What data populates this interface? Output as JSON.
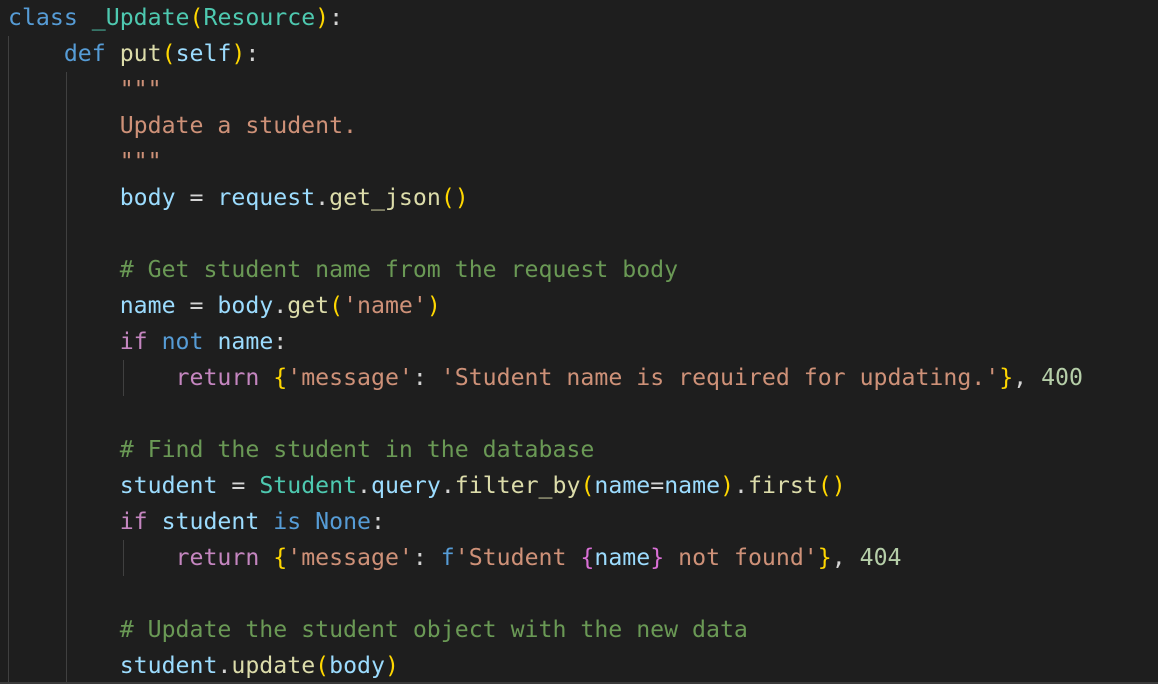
{
  "editor": {
    "background": "#1e1e1e",
    "token_colors": {
      "keyword": "#569cd6",
      "control": "#c586c0",
      "class": "#4ec9b0",
      "function": "#dcdcaa",
      "variable": "#9cdcfe",
      "string": "#ce9178",
      "comment": "#6a9955",
      "number": "#b5cea8",
      "bracket_1": "#ffd700",
      "bracket_2": "#da70d6"
    },
    "lines": [
      {
        "tokens": [
          {
            "t": "class",
            "c": "kw-decl"
          },
          {
            "t": " ",
            "c": "op"
          },
          {
            "t": "_Update",
            "c": "cls"
          },
          {
            "t": "(",
            "c": "b1"
          },
          {
            "t": "Resource",
            "c": "cls"
          },
          {
            "t": ")",
            "c": "b1"
          },
          {
            "t": ":",
            "c": "op"
          }
        ]
      },
      {
        "tokens": [
          {
            "t": "    ",
            "c": "op"
          },
          {
            "t": "def",
            "c": "kw-decl"
          },
          {
            "t": " ",
            "c": "op"
          },
          {
            "t": "put",
            "c": "fn"
          },
          {
            "t": "(",
            "c": "b1"
          },
          {
            "t": "self",
            "c": "var"
          },
          {
            "t": ")",
            "c": "b1"
          },
          {
            "t": ":",
            "c": "op"
          }
        ]
      },
      {
        "tokens": [
          {
            "t": "        ",
            "c": "op"
          },
          {
            "t": "\"\"\"",
            "c": "str"
          }
        ]
      },
      {
        "tokens": [
          {
            "t": "        ",
            "c": "op"
          },
          {
            "t": "Update a student.",
            "c": "str"
          }
        ]
      },
      {
        "tokens": [
          {
            "t": "        ",
            "c": "op"
          },
          {
            "t": "\"\"\"",
            "c": "str"
          }
        ]
      },
      {
        "tokens": [
          {
            "t": "        ",
            "c": "op"
          },
          {
            "t": "body",
            "c": "var"
          },
          {
            "t": " = ",
            "c": "op"
          },
          {
            "t": "request",
            "c": "var"
          },
          {
            "t": ".",
            "c": "op"
          },
          {
            "t": "get_json",
            "c": "fn"
          },
          {
            "t": "()",
            "c": "b1"
          }
        ]
      },
      {
        "tokens": []
      },
      {
        "tokens": [
          {
            "t": "        ",
            "c": "op"
          },
          {
            "t": "# Get student name from the request body",
            "c": "cmt"
          }
        ]
      },
      {
        "tokens": [
          {
            "t": "        ",
            "c": "op"
          },
          {
            "t": "name",
            "c": "var"
          },
          {
            "t": " = ",
            "c": "op"
          },
          {
            "t": "body",
            "c": "var"
          },
          {
            "t": ".",
            "c": "op"
          },
          {
            "t": "get",
            "c": "fn"
          },
          {
            "t": "(",
            "c": "b1"
          },
          {
            "t": "'name'",
            "c": "str"
          },
          {
            "t": ")",
            "c": "b1"
          }
        ]
      },
      {
        "tokens": [
          {
            "t": "        ",
            "c": "op"
          },
          {
            "t": "if",
            "c": "kw-ctrl"
          },
          {
            "t": " ",
            "c": "op"
          },
          {
            "t": "not",
            "c": "kw-decl"
          },
          {
            "t": " ",
            "c": "op"
          },
          {
            "t": "name",
            "c": "var"
          },
          {
            "t": ":",
            "c": "op"
          }
        ]
      },
      {
        "tokens": [
          {
            "t": "            ",
            "c": "op"
          },
          {
            "t": "return",
            "c": "kw-ctrl"
          },
          {
            "t": " ",
            "c": "op"
          },
          {
            "t": "{",
            "c": "b1"
          },
          {
            "t": "'message'",
            "c": "str"
          },
          {
            "t": ": ",
            "c": "op"
          },
          {
            "t": "'Student name is required for updating.'",
            "c": "str"
          },
          {
            "t": "}",
            "c": "b1"
          },
          {
            "t": ", ",
            "c": "op"
          },
          {
            "t": "400",
            "c": "num"
          }
        ]
      },
      {
        "tokens": []
      },
      {
        "tokens": [
          {
            "t": "        ",
            "c": "op"
          },
          {
            "t": "# Find the student in the database",
            "c": "cmt"
          }
        ]
      },
      {
        "tokens": [
          {
            "t": "        ",
            "c": "op"
          },
          {
            "t": "student",
            "c": "var"
          },
          {
            "t": " = ",
            "c": "op"
          },
          {
            "t": "Student",
            "c": "cls"
          },
          {
            "t": ".",
            "c": "op"
          },
          {
            "t": "query",
            "c": "var"
          },
          {
            "t": ".",
            "c": "op"
          },
          {
            "t": "filter_by",
            "c": "fn"
          },
          {
            "t": "(",
            "c": "b1"
          },
          {
            "t": "name",
            "c": "var"
          },
          {
            "t": "=",
            "c": "op"
          },
          {
            "t": "name",
            "c": "var"
          },
          {
            "t": ")",
            "c": "b1"
          },
          {
            "t": ".",
            "c": "op"
          },
          {
            "t": "first",
            "c": "fn"
          },
          {
            "t": "()",
            "c": "b1"
          }
        ]
      },
      {
        "tokens": [
          {
            "t": "        ",
            "c": "op"
          },
          {
            "t": "if",
            "c": "kw-ctrl"
          },
          {
            "t": " ",
            "c": "op"
          },
          {
            "t": "student",
            "c": "var"
          },
          {
            "t": " ",
            "c": "op"
          },
          {
            "t": "is",
            "c": "kw-decl"
          },
          {
            "t": " ",
            "c": "op"
          },
          {
            "t": "None",
            "c": "kw-decl"
          },
          {
            "t": ":",
            "c": "op"
          }
        ]
      },
      {
        "tokens": [
          {
            "t": "            ",
            "c": "op"
          },
          {
            "t": "return",
            "c": "kw-ctrl"
          },
          {
            "t": " ",
            "c": "op"
          },
          {
            "t": "{",
            "c": "b1"
          },
          {
            "t": "'message'",
            "c": "str"
          },
          {
            "t": ": ",
            "c": "op"
          },
          {
            "t": "f",
            "c": "kw-decl"
          },
          {
            "t": "'Student ",
            "c": "str"
          },
          {
            "t": "{",
            "c": "b2"
          },
          {
            "t": "name",
            "c": "var"
          },
          {
            "t": "}",
            "c": "b2"
          },
          {
            "t": " not found'",
            "c": "str"
          },
          {
            "t": "}",
            "c": "b1"
          },
          {
            "t": ", ",
            "c": "op"
          },
          {
            "t": "404",
            "c": "num"
          }
        ]
      },
      {
        "tokens": []
      },
      {
        "tokens": [
          {
            "t": "        ",
            "c": "op"
          },
          {
            "t": "# Update the student object with the new data",
            "c": "cmt"
          }
        ]
      },
      {
        "tokens": [
          {
            "t": "        ",
            "c": "op"
          },
          {
            "t": "student",
            "c": "var"
          },
          {
            "t": ".",
            "c": "op"
          },
          {
            "t": "update",
            "c": "fn"
          },
          {
            "t": "(",
            "c": "b1"
          },
          {
            "t": "body",
            "c": "var"
          },
          {
            "t": ")",
            "c": "b1"
          }
        ]
      }
    ]
  }
}
